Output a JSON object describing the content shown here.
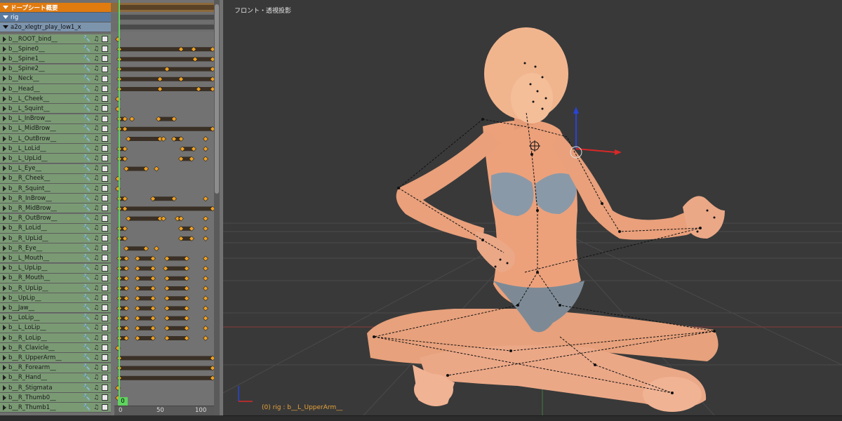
{
  "dopesheet": {
    "summary_label": "ドープシート概要",
    "rig_label": "rig",
    "action_label": "a2o_xlegtr_play_low1_x",
    "bones": [
      "b__ROOT_bind__",
      "b__Spine0__",
      "b__Spine1__",
      "b__Spine2__",
      "b__Neck__",
      "b__Head__",
      "b__L_Cheek__",
      "b__L_Squint__",
      "b__L_InBrow__",
      "b__L_MidBrow__",
      "b__L_OutBrow__",
      "b__L_LoLid__",
      "b__L_UpLid__",
      "b__L_Eye__",
      "b__R_Cheek__",
      "b__R_Squint__",
      "b__R_InBrow__",
      "b__R_MidBrow__",
      "b__R_OutBrow__",
      "b__R_LoLid__",
      "b__R_UpLid__",
      "b__R_Eye__",
      "b__L_Mouth__",
      "b__L_UpLip__",
      "b__R_Mouth__",
      "b__R_UpLip__",
      "b__UpLip__",
      "b__Jaw__",
      "b__LoLip__",
      "b__L_LoLip__",
      "b__R_LoLip__",
      "b__R_Clavicle__",
      "b__R_UpperArm__",
      "b__R_Forearm__",
      "b__R_Hand__",
      "b__R_Stigmata",
      "b__R_Thumb0__",
      "b__R_Thumb1__"
    ],
    "current_frame": "0",
    "ruler_ticks": [
      "0",
      "50",
      "100"
    ]
  },
  "viewport": {
    "title": "フロント・透視投影",
    "status": "(0) rig : b__L_UpperArm__"
  },
  "colors": {
    "summary": "#e07b10",
    "rig": "#5a7aa0",
    "bone_channel": "#7a9a74",
    "keyframe": "#f0a020",
    "playhead": "#5fd35f",
    "status_text": "#e8a33a"
  }
}
